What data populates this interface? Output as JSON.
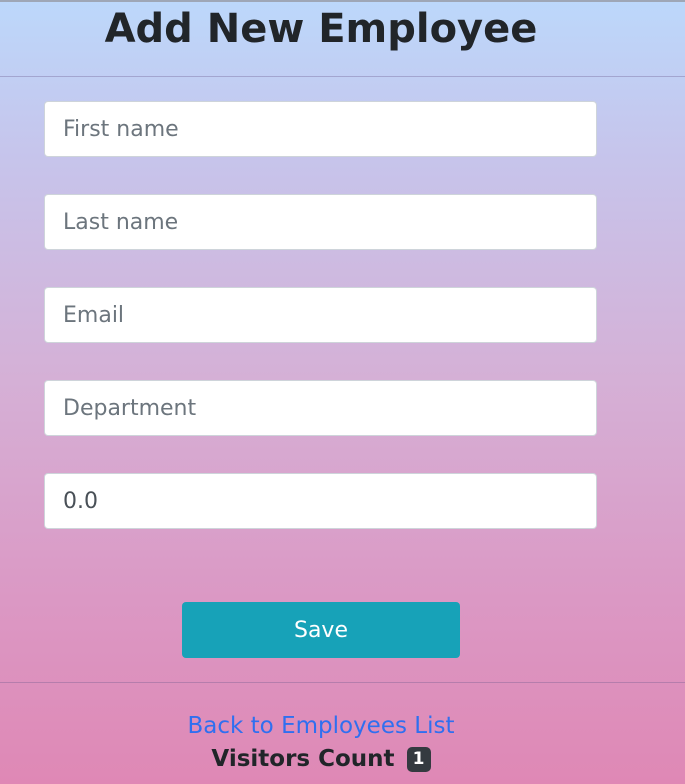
{
  "header": {
    "title": "Add New Employee"
  },
  "form": {
    "first_name": {
      "placeholder": "First name",
      "value": ""
    },
    "last_name": {
      "placeholder": "Last name",
      "value": ""
    },
    "email": {
      "placeholder": "Email",
      "value": ""
    },
    "department": {
      "placeholder": "Department",
      "value": ""
    },
    "salary": {
      "placeholder": "",
      "value": "0.0"
    },
    "save_label": "Save"
  },
  "footer": {
    "back_link": "Back to Employees List",
    "visitors_label": "Visitors Count",
    "visitors_count": "1"
  },
  "colors": {
    "save_button": "#17a2b8",
    "link": "#2f6ff0",
    "badge": "#343a40"
  }
}
